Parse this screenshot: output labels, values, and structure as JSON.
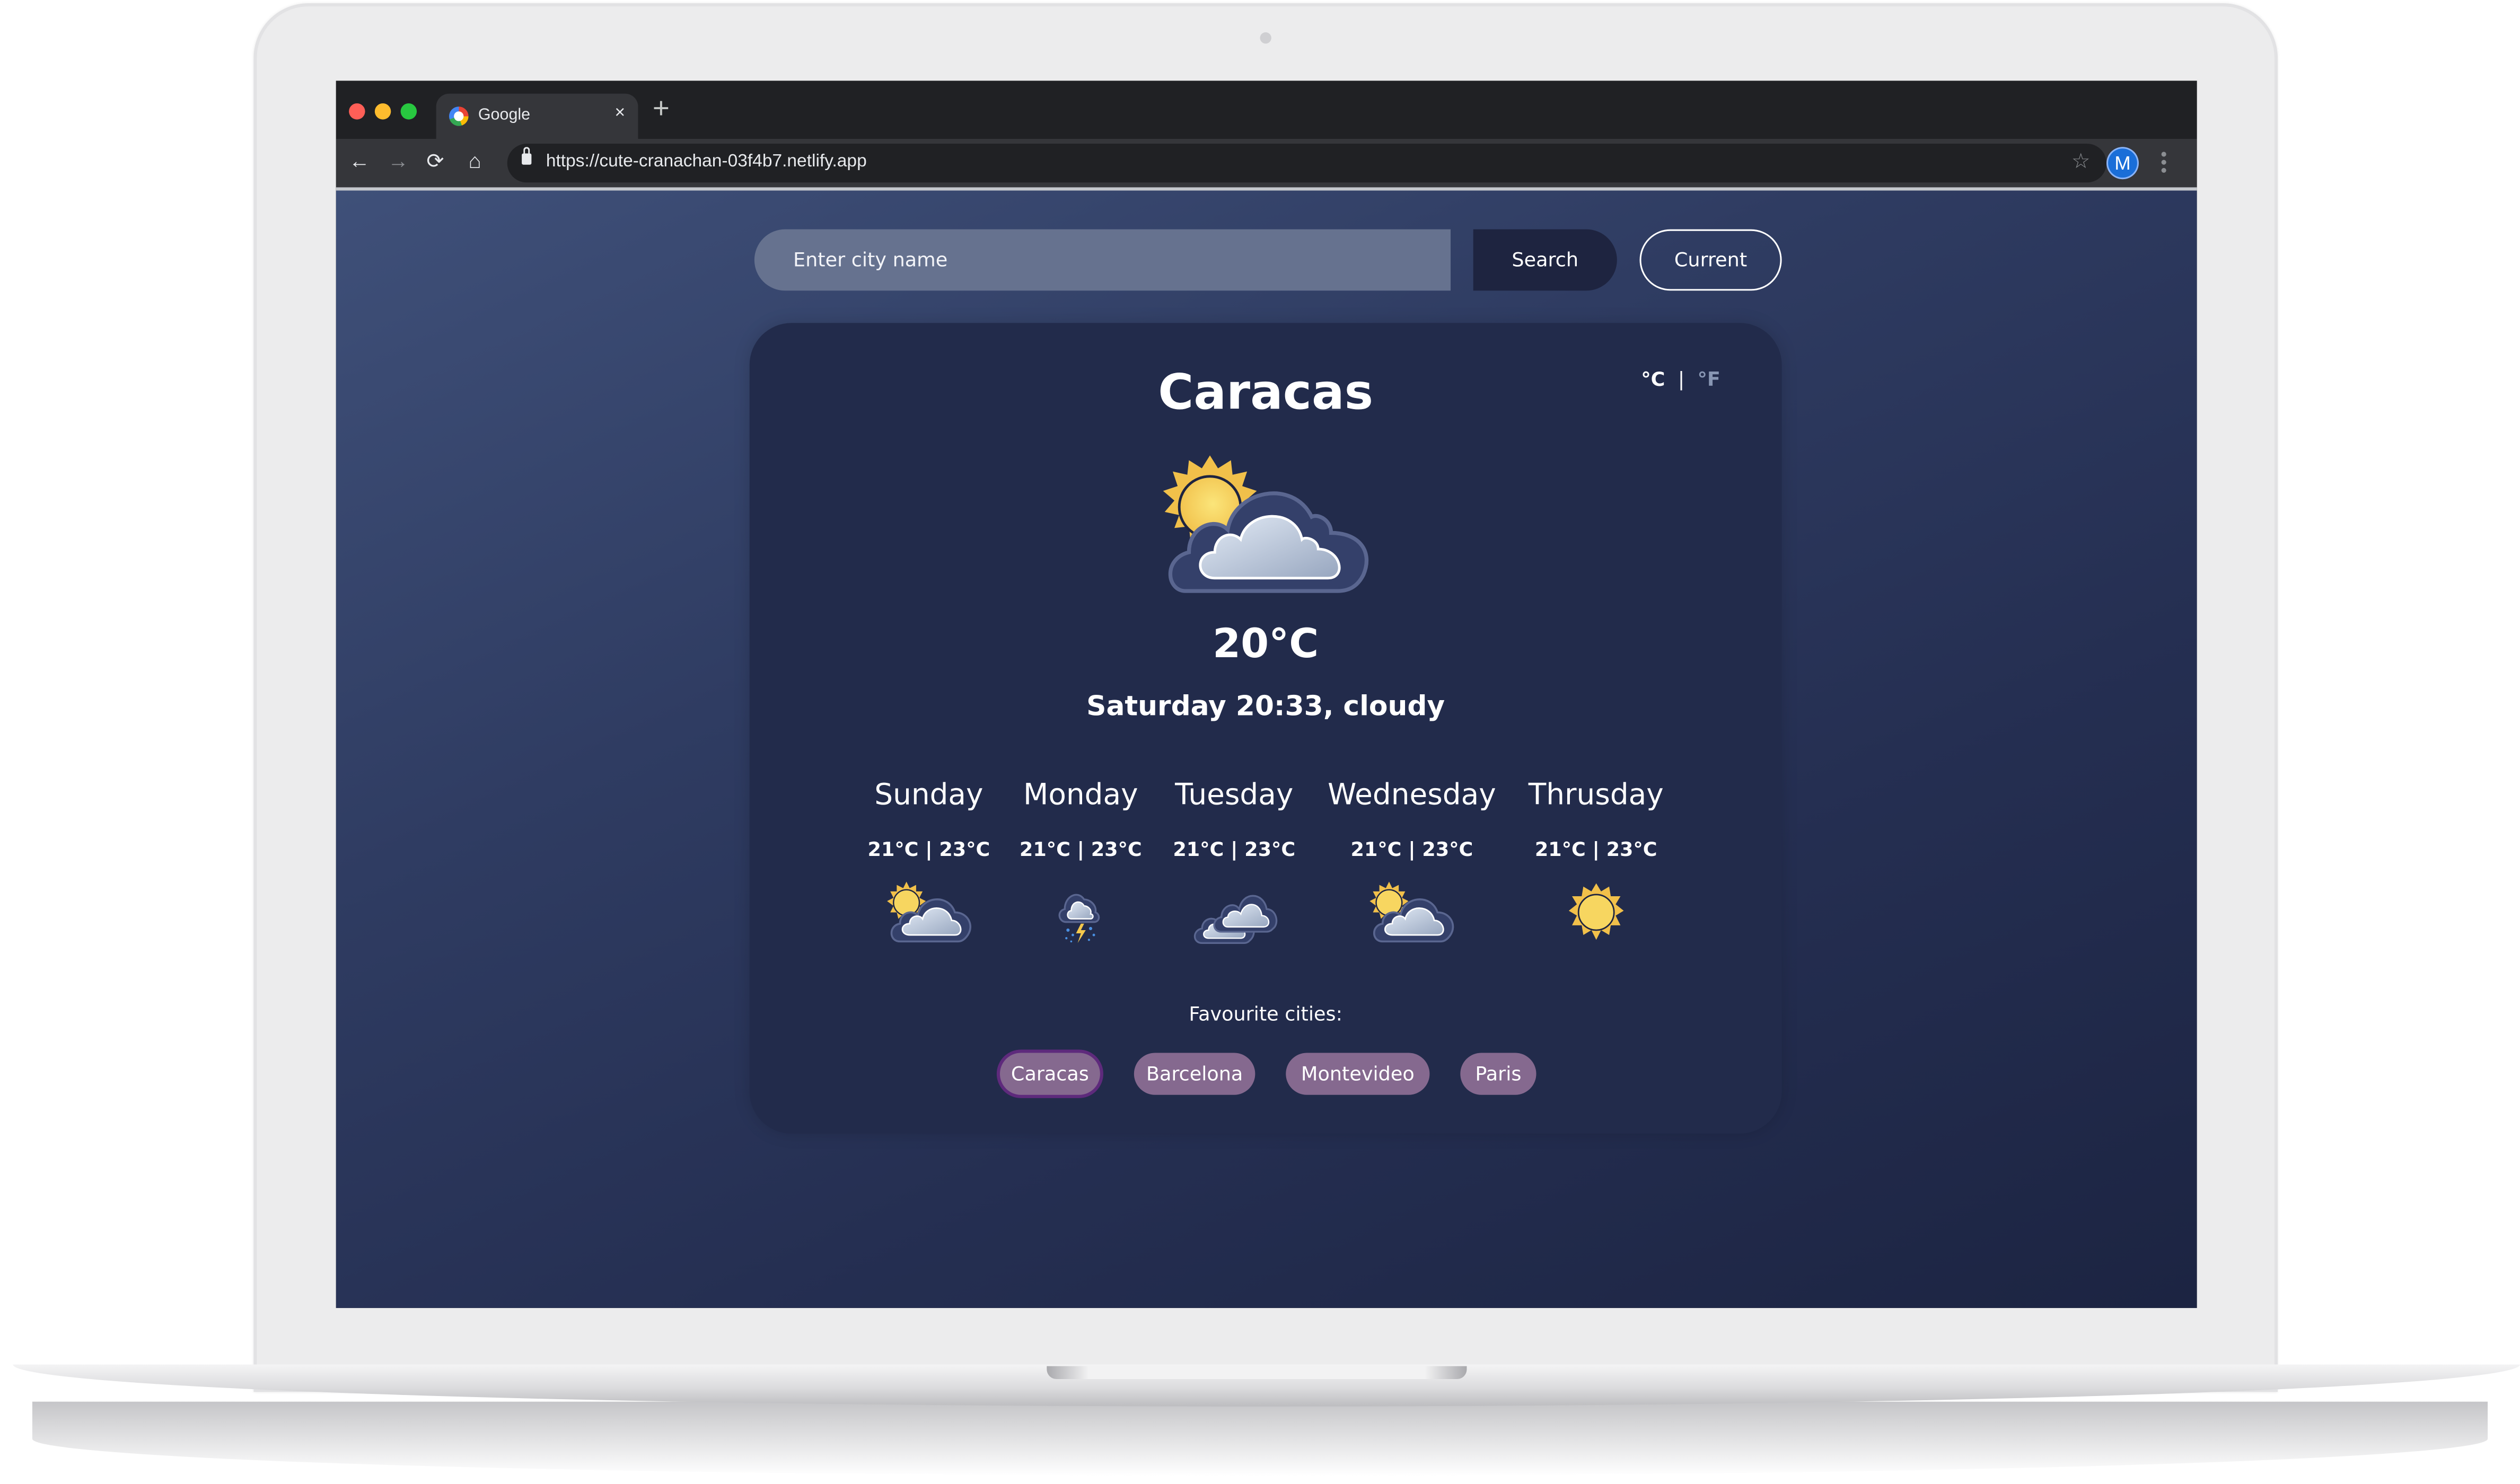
{
  "browser": {
    "tab_title": "Google",
    "tab_close": "×",
    "new_tab": "+",
    "nav": {
      "back": "←",
      "forward": "→",
      "reload": "⟳",
      "home": "⌂"
    },
    "url": "https://cute-cranachan-03f4b7.netlify.app",
    "bookmark_star": "☆",
    "profile_initial": "M"
  },
  "search": {
    "placeholder": "Enter city name",
    "value": "",
    "search_label": "Search",
    "current_label": "Current"
  },
  "weather": {
    "city": "Caracas",
    "units": {
      "celsius": "°C",
      "separator": "|",
      "fahrenheit": "°F",
      "active": "celsius"
    },
    "icon": "partly-cloudy",
    "temperature": "20°C",
    "description": "Saturday 20:33, cloudy",
    "forecast": [
      {
        "day": "Sunday",
        "temps": "21°C | 23°C",
        "icon": "partly-cloudy"
      },
      {
        "day": "Monday",
        "temps": "21°C | 23°C",
        "icon": "thunderstorm"
      },
      {
        "day": "Tuesday",
        "temps": "21°C | 23°C",
        "icon": "cloudy"
      },
      {
        "day": "Wednesday",
        "temps": "21°C | 23°C",
        "icon": "partly-cloudy"
      },
      {
        "day": "Thrusday",
        "temps": "21°C | 23°C",
        "icon": "sunny"
      }
    ]
  },
  "favourites": {
    "label": "Favourite cities:",
    "cities": [
      "Caracas",
      "Barcelona",
      "Montevideo",
      "Paris"
    ],
    "active": "Caracas"
  },
  "colors": {
    "chip": "#85698f",
    "chip_active_border": "#5e2a7c",
    "card": "#222b4b",
    "unit_inactive": "#8896b3",
    "sun": "#f4c84c"
  }
}
